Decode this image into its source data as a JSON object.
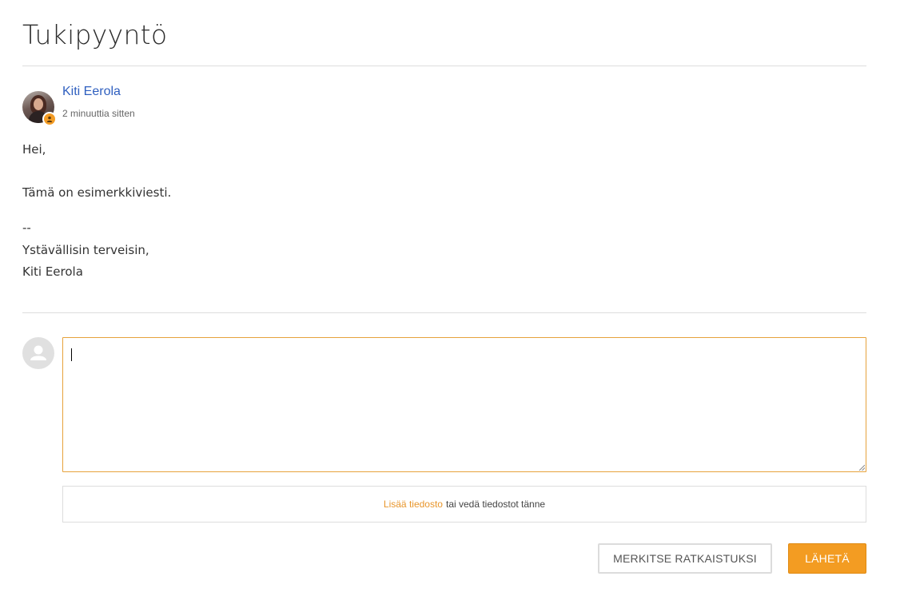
{
  "page": {
    "title": "Tukipyyntö"
  },
  "message": {
    "author": "Kiti Eerola",
    "timestamp": "2 minuuttia sitten",
    "body_lines": [
      "Hei,",
      "Tämä on esimerkkiviesti.",
      "--",
      "Ystävällisin terveisin,",
      "Kiti Eerola"
    ]
  },
  "reply": {
    "value": "",
    "dropzone_link": "Lisää tiedosto",
    "dropzone_text": "tai vedä tiedostot tänne"
  },
  "actions": {
    "mark_resolved": "MERKITSE RATKAISTUKSI",
    "send": "LÄHETÄ"
  },
  "colors": {
    "accent": "#f39c22",
    "link": "#2f5fbf"
  },
  "icons": {
    "author_badge": "user-icon",
    "reply_avatar": "user-placeholder-icon"
  }
}
